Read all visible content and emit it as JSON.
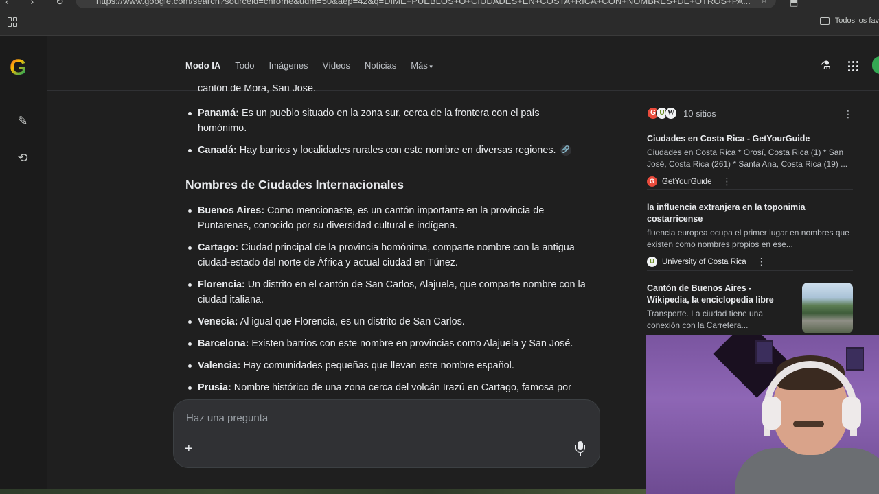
{
  "browser": {
    "url": "https://www.google.com/search?sourceid=chrome&udm=50&aep=42&q=DIME+PUEBLOS+O+CIUDADES+EN+COSTA+RICA+CON+NOMBRES+DE+OTROS+PA...",
    "bookmarks_all": "Todos los fav"
  },
  "topbar": {
    "tabs": [
      {
        "label": "Modo IA"
      },
      {
        "label": "Todo"
      },
      {
        "label": "Imágenes"
      },
      {
        "label": "Vídeos"
      },
      {
        "label": "Noticias"
      },
      {
        "label": "Más"
      }
    ]
  },
  "main": {
    "fragment_top": "cantón de Mora, San José.",
    "list1": [
      {
        "name": "Panamá:",
        "text": " Es un pueblo situado en la zona sur, cerca de la frontera con el país homónimo."
      },
      {
        "name": "Canadá:",
        "text": " Hay barrios y localidades rurales con este nombre en diversas regiones."
      }
    ],
    "heading": "Nombres de Ciudades Internacionales",
    "list2": [
      {
        "name": "Buenos Aires:",
        "text": " Como mencionaste, es un cantón importante en la provincia de Puntarenas, conocido por su diversidad cultural e indígena."
      },
      {
        "name": "Cartago:",
        "text": " Ciudad principal de la provincia homónima, comparte nombre con la antigua ciudad-estado del norte de África y actual ciudad en Túnez."
      },
      {
        "name": "Florencia:",
        "text": " Un distrito en el cantón de San Carlos, Alajuela, que comparte nombre con la ciudad italiana."
      },
      {
        "name": "Venecia:",
        "text": " Al igual que Florencia, es un distrito de San Carlos."
      },
      {
        "name": "Barcelona:",
        "text": " Existen barrios con este nombre en provincias como Alajuela y San José."
      },
      {
        "name": "Valencia:",
        "text": " Hay comunidades pequeñas que llevan este nombre español."
      },
      {
        "name": "Prusia:",
        "text": " Nombre histórico de una zona cerca del volcán Irazú en Cartago, famosa por"
      }
    ]
  },
  "prompt": {
    "placeholder": "Haz una pregunta",
    "plus": "+"
  },
  "sources": {
    "count_label": "10 sitios",
    "favicons": [
      "G",
      "U",
      "W"
    ],
    "cards": [
      {
        "title": "Ciudades en Costa Rica - GetYourGuide",
        "snippet": "Ciudades en Costa Rica * Orosí, Costa Rica (1) * San José, Costa Rica (261) * Santa Ana, Costa Rica (19) ...",
        "site": "GetYourGuide",
        "fav": "G"
      },
      {
        "title": "la influencia extranjera en la toponimia costarricense",
        "snippet": "fluencia europea ocupa el primer lugar en nombres que existen como nombres propios en ese...",
        "site": "University of Costa Rica",
        "fav": "U"
      },
      {
        "title": "Cantón de Buenos Aires - Wikipedia, la enciclopedia libre",
        "snippet": "Transporte. La ciudad tiene una conexión con la Carretera...",
        "site": "",
        "fav": ""
      }
    ]
  },
  "colors": {
    "background": "#1f1f1f",
    "accent": "#8ab4f8",
    "text": "#e8eaed"
  },
  "icons": [
    "apps-icon",
    "folder-icon",
    "google-g-icon",
    "new-chat-icon",
    "history-icon",
    "labs-flask-icon",
    "google-apps-icon",
    "link-icon",
    "plus-icon",
    "mic-icon",
    "more-vert-icon"
  ]
}
